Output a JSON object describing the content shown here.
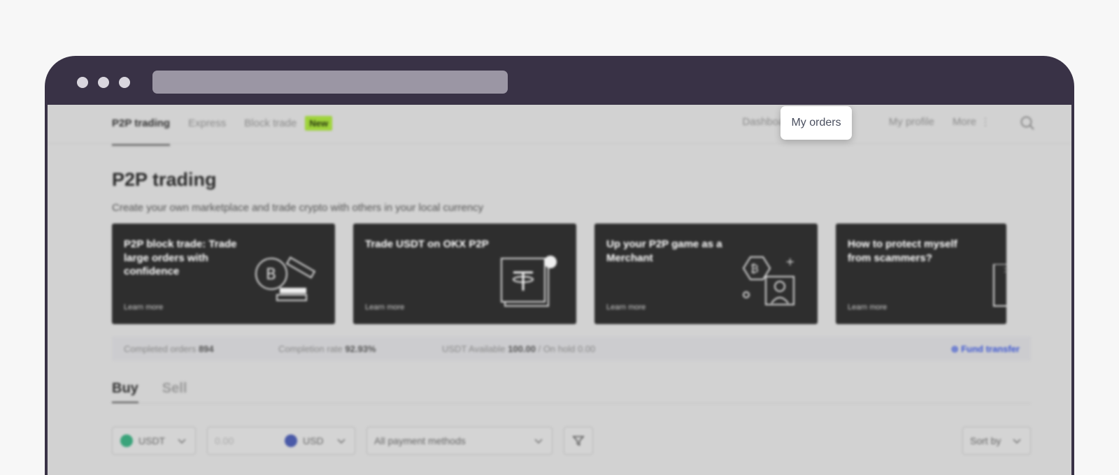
{
  "nav": {
    "left": [
      "P2P trading",
      "Express",
      "Block trade"
    ],
    "new_badge": "New",
    "right": [
      "Dashboard",
      "My orders",
      "My profile",
      "More"
    ]
  },
  "page": {
    "title": "P2P trading",
    "subtitle": "Create your own marketplace and trade crypto with others in your local currency"
  },
  "cards": [
    {
      "title": "P2P block trade: Trade large orders with confidence",
      "learn": "Learn more"
    },
    {
      "title": "Trade USDT on OKX P2P",
      "learn": "Learn more"
    },
    {
      "title": "Up your P2P game as a Merchant",
      "learn": "Learn more"
    },
    {
      "title": "How to protect myself from scammers?",
      "learn": "Learn more"
    }
  ],
  "stats": {
    "completed_label": "Completed orders",
    "completed_value": "894",
    "rate_label": "Completion rate",
    "rate_value": "92.93%",
    "available_label": "USDT Available",
    "available_value": "100.00",
    "hold_text": "/ On hold 0.00",
    "fund_transfer": "Fund transfer"
  },
  "tabs": [
    "Buy",
    "Sell"
  ],
  "filters": {
    "crypto": "USDT",
    "amount_placeholder": "0.00",
    "fiat": "USD",
    "payment": "All payment methods",
    "sort": "Sort by"
  },
  "colors": {
    "window_frame": "#393246",
    "new_badge": "#9fd33c",
    "fund_link": "#3d57d1"
  }
}
